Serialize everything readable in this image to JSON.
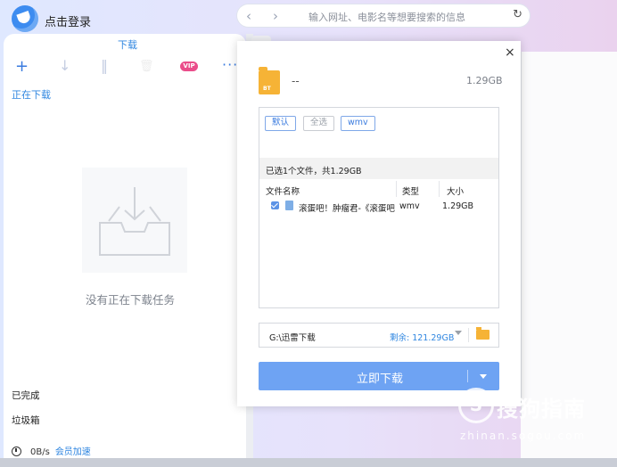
{
  "header": {
    "login_label": "点击登录",
    "back_icon": "‹",
    "forward_icon": "›",
    "address_placeholder": "输入网址、电影名等想要搜索的信息",
    "refresh_icon": "↻"
  },
  "sidebar": {
    "title": "下载",
    "toolbar": {
      "add_icon": "+",
      "download_icon": "↓",
      "pause_icon": "‖",
      "delete_icon": "🗑",
      "vip_label": "VIP",
      "more_icon": "···"
    },
    "active_tab": "正在下载",
    "empty_message": "没有正在下载任务",
    "completed_label": "已完成",
    "trash_label": "垃圾箱",
    "speed": "0B/s",
    "speedup_link": "会员加速"
  },
  "dialog": {
    "close_icon": "×",
    "bt_label": "BT",
    "task_name": "--",
    "total_size": "1.29GB",
    "filters": [
      "默认",
      "全选",
      "wmv"
    ],
    "selection_summary": "已选1个文件，共1.29GB",
    "columns": {
      "name": "文件名称",
      "type": "类型",
      "size": "大小"
    },
    "files": [
      {
        "name": "滚蛋吧！肿瘤君-《滚蛋吧！肿瘤君》",
        "type": "wmv",
        "size": "1.29GB",
        "checked": true
      }
    ],
    "save_path": "G:\\迅雷下载",
    "free_space": "剩余: 121.29GB",
    "download_button": "立即下载"
  },
  "watermark": {
    "logo_char": "S",
    "text": "搜狗指南",
    "url": "zhinan.sogou.com"
  },
  "colors": {
    "accent": "#2f86e0",
    "download_button": "#6ea3f3",
    "vip": "#ea4d8a",
    "folder": "#f6b336"
  }
}
